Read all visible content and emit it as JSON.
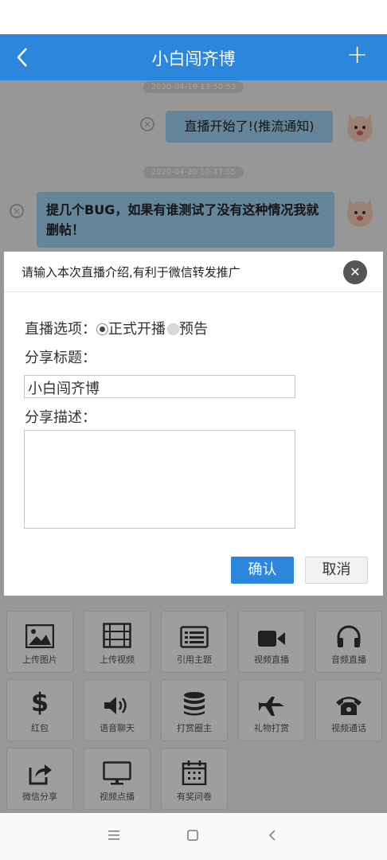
{
  "header": {
    "title": "小白闯齐博",
    "back_icon": "chevron-left-icon",
    "add_icon": "plus-icon"
  },
  "chat": {
    "messages": [
      {
        "time": "2020-04-19 13:50:53",
        "text": "直播开始了!(推流通知)"
      },
      {
        "time": "2020-04-20 10:47:55",
        "text": "提几个BUG，如果有谁测试了没有这种情况我就删帖！"
      }
    ]
  },
  "dialog": {
    "title": "请输入本次直播介绍,有利于微信转发推广",
    "option_label": "直播选项：",
    "option_live": "正式开播",
    "option_preview": "预告",
    "share_title_label": "分享标题：",
    "share_title_value": "小白闯齐博",
    "share_desc_label": "分享描述：",
    "share_desc_value": "",
    "confirm": "确认",
    "cancel": "取消"
  },
  "toolbar": {
    "items": [
      {
        "label": "上传图片",
        "icon": "image-icon"
      },
      {
        "label": "上传视频",
        "icon": "film-icon"
      },
      {
        "label": "引用主题",
        "icon": "list-icon"
      },
      {
        "label": "视频直播",
        "icon": "video-camera-icon"
      },
      {
        "label": "音频直播",
        "icon": "headphones-icon"
      },
      {
        "label": "红包",
        "icon": "dollar-icon"
      },
      {
        "label": "语音聊天",
        "icon": "speaker-icon"
      },
      {
        "label": "打赏圈主",
        "icon": "coin-stack-icon"
      },
      {
        "label": "礼物打赏",
        "icon": "plane-icon"
      },
      {
        "label": "视频通话",
        "icon": "phone-icon"
      },
      {
        "label": "微信分享",
        "icon": "share-icon"
      },
      {
        "label": "视频点播",
        "icon": "monitor-icon"
      },
      {
        "label": "有奖问卷",
        "icon": "calendar-icon"
      }
    ]
  },
  "colors": {
    "accent": "#2b86dc",
    "bubble": "#9ed1f2"
  }
}
